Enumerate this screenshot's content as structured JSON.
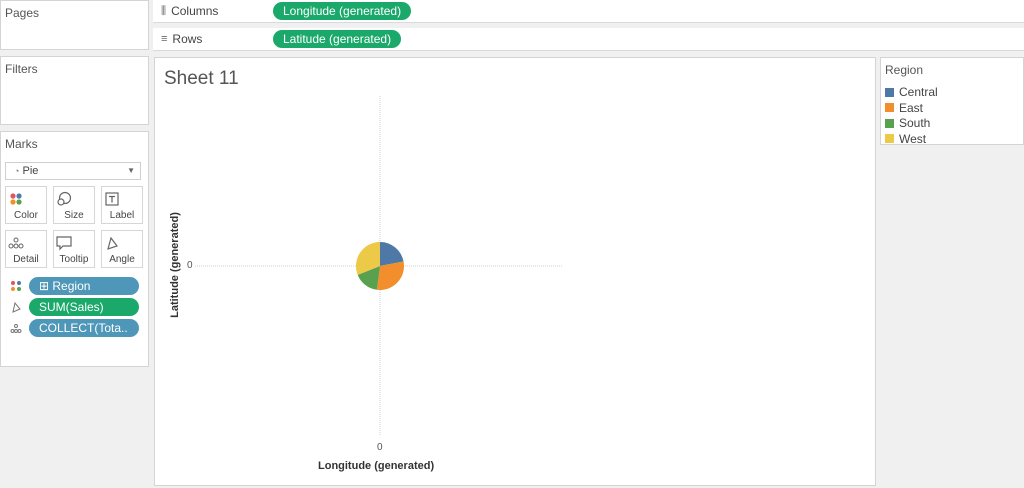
{
  "sidebar": {
    "pages_title": "Pages",
    "filters_title": "Filters",
    "marks": {
      "title": "Marks",
      "type": "Pie",
      "buttons": [
        {
          "label": "Color",
          "icon": "color-dots-icon"
        },
        {
          "label": "Size",
          "icon": "size-icon"
        },
        {
          "label": "Label",
          "icon": "label-icon"
        },
        {
          "label": "Detail",
          "icon": "detail-icon"
        },
        {
          "label": "Tooltip",
          "icon": "tooltip-icon"
        },
        {
          "label": "Angle",
          "icon": "angle-icon"
        }
      ],
      "fields": [
        {
          "icon": "color-dots-icon",
          "label": "⊞ Region",
          "color": "#4f97b8"
        },
        {
          "icon": "angle-icon",
          "label": "SUM(Sales)",
          "color": "#1aa96a"
        },
        {
          "icon": "detail-icon",
          "label": "COLLECT(Tota..",
          "color": "#4f97b8"
        }
      ]
    }
  },
  "shelves": {
    "columns": {
      "label": "Columns",
      "icon": "columns-icon",
      "pill": "Longitude (generated)"
    },
    "rows": {
      "label": "Rows",
      "icon": "rows-icon",
      "pill": "Latitude (generated)"
    }
  },
  "sheet": {
    "title": "Sheet 11"
  },
  "legend": {
    "title": "Region",
    "items": [
      {
        "label": "Central",
        "color": "#4e79a7"
      },
      {
        "label": "East",
        "color": "#f28e2b"
      },
      {
        "label": "South",
        "color": "#59a14f"
      },
      {
        "label": "West",
        "color": "#edc948"
      }
    ]
  },
  "chart_data": {
    "type": "pie",
    "xlabel": "Longitude (generated)",
    "ylabel": "Latitude (generated)",
    "x_ticks": [
      "0"
    ],
    "y_ticks": [
      "0"
    ],
    "grid": false,
    "series": [
      {
        "name": "Central",
        "value": 22,
        "color": "#4e79a7"
      },
      {
        "name": "East",
        "value": 30,
        "color": "#f28e2b"
      },
      {
        "name": "South",
        "value": 17,
        "color": "#59a14f"
      },
      {
        "name": "West",
        "value": 31,
        "color": "#edc948"
      }
    ]
  },
  "colors": {
    "pill_green": "#1aa96a",
    "pill_blue": "#4f97b8"
  }
}
